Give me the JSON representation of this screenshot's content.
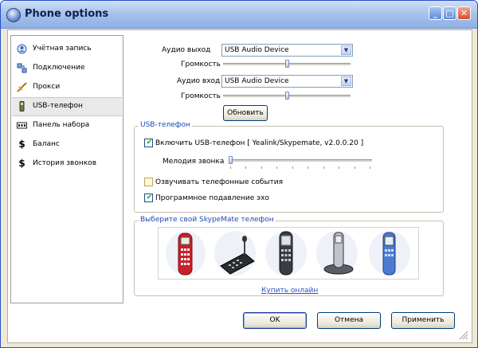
{
  "window": {
    "title": "Phone options",
    "minimize_glyph": "_",
    "maximize_glyph": "□",
    "close_glyph": "✕"
  },
  "sidebar": {
    "items": [
      {
        "label": "Учётная запись",
        "icon": "account-icon",
        "selected": false
      },
      {
        "label": "Подключение",
        "icon": "connection-icon",
        "selected": false
      },
      {
        "label": "Прокси",
        "icon": "proxy-icon",
        "selected": false
      },
      {
        "label": "USB-телефон",
        "icon": "usb-phone-icon",
        "selected": true
      },
      {
        "label": "Панель набора",
        "icon": "dialpad-icon",
        "selected": false
      },
      {
        "label": "Баланс",
        "icon": "dollar-icon",
        "selected": false
      },
      {
        "label": "История звонков",
        "icon": "dollar-icon",
        "selected": false
      }
    ]
  },
  "audio": {
    "output_label": "Аудио выход",
    "output_value": "USB Audio Device",
    "volume_label": "Громкость",
    "output_volume": 0.35,
    "input_label": "Аудио вход",
    "input_value": "USB Audio Device",
    "input_volume": 0.35,
    "refresh_label": "Обновить"
  },
  "usb_phone": {
    "legend": "USB-телефон",
    "enable_label": "Включить USB-телефон [ Yealink/Skypemate, v2.0.0.20 ]",
    "enable_checked": true,
    "ringtone_label": "Мелодия звонка",
    "ringtone_level": 0.0,
    "announce_label": "Озвучивать телефонные события",
    "announce_checked": false,
    "echo_label": "Программное подавление эхо",
    "echo_checked": true
  },
  "skypemate": {
    "legend": "Выберите свой SkypeMate телефон",
    "buy_link": "Купить онлайн"
  },
  "buttons": {
    "ok": "OK",
    "cancel": "Отмена",
    "apply": "Применить"
  },
  "colors": {
    "accent": "#1f49b6",
    "titlebar": "#a9c3eb",
    "check": "#21a121"
  }
}
